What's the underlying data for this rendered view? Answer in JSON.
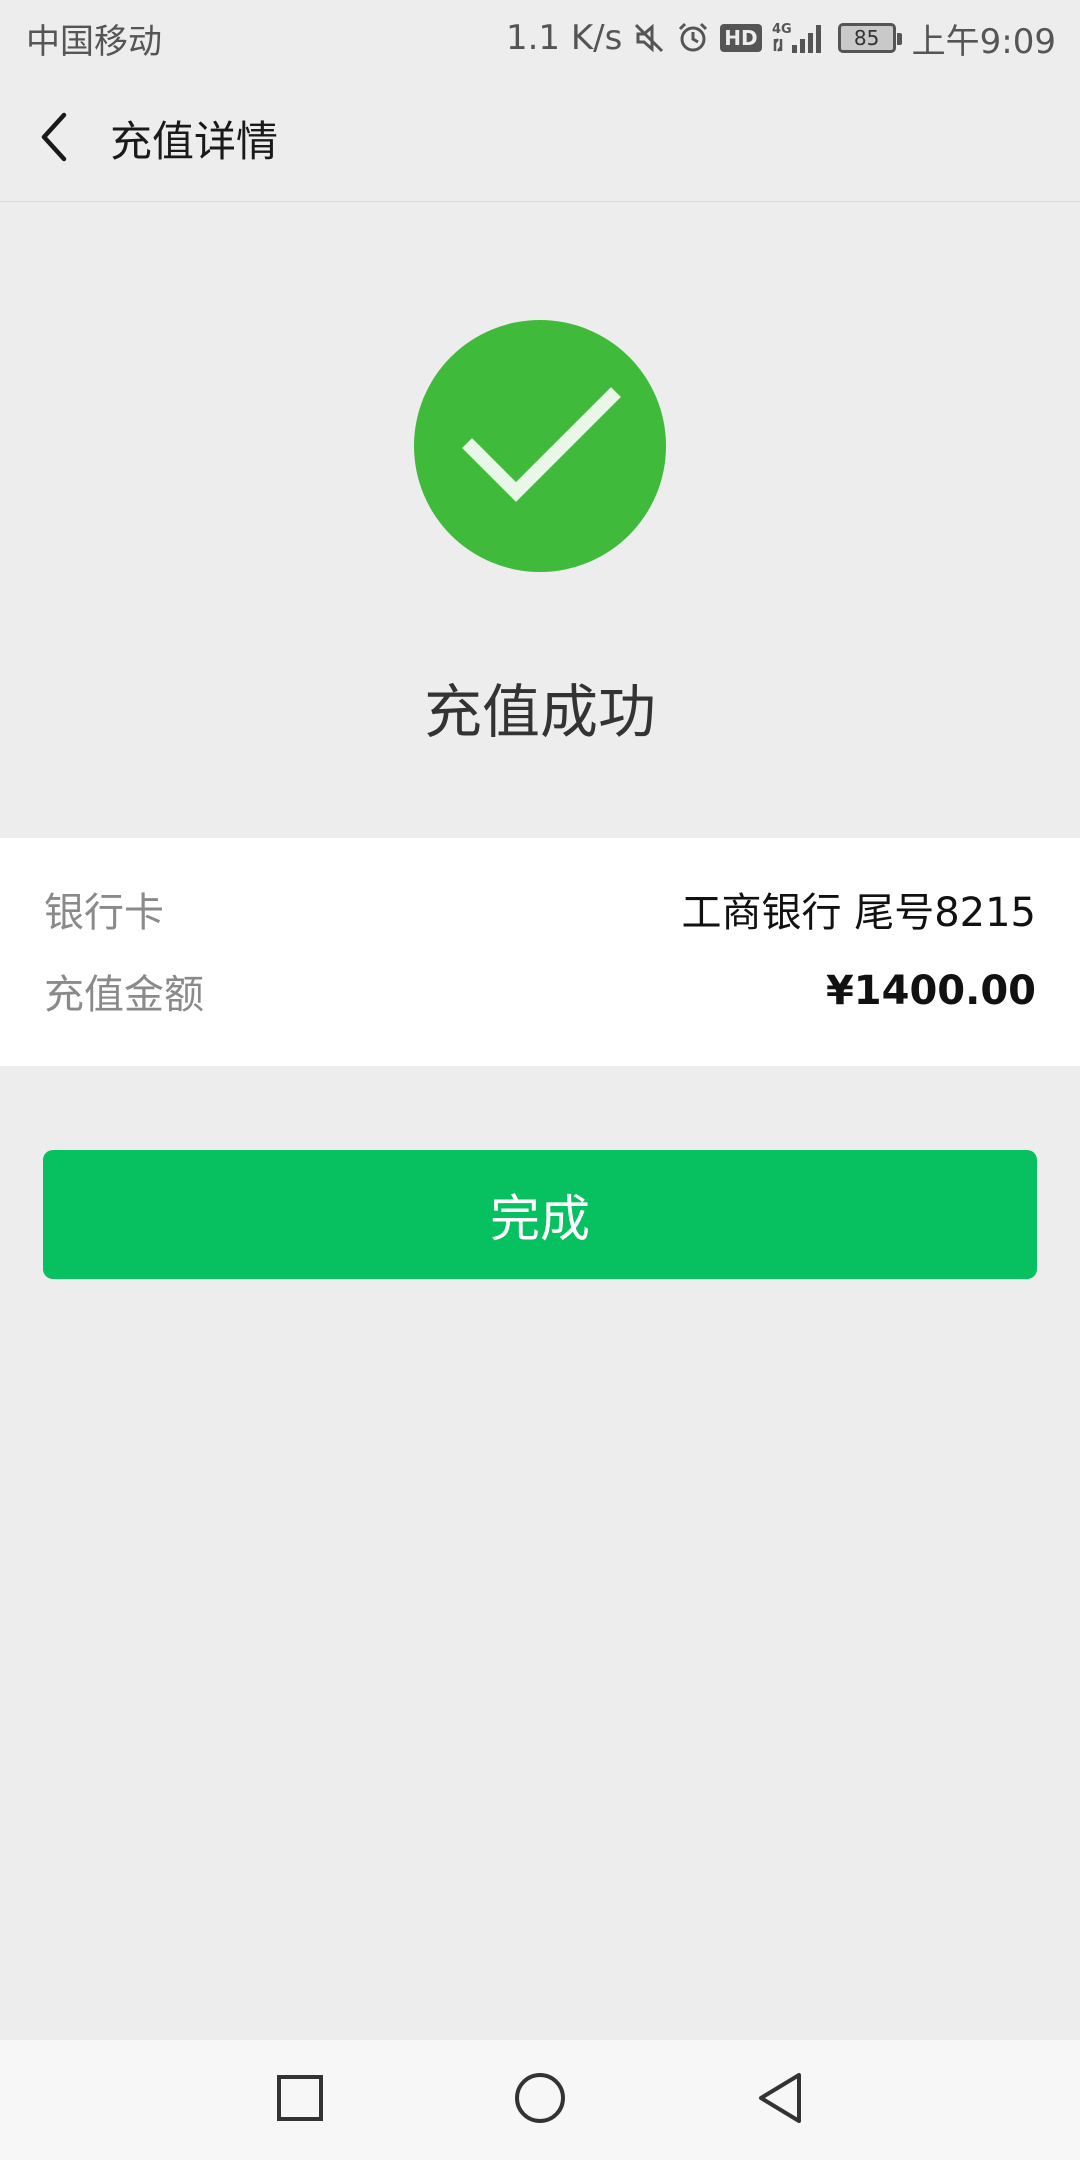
{
  "status_bar": {
    "carrier": "中国移动",
    "speed": "1.1 K/s",
    "hd": "HD",
    "network": "4G",
    "battery": "85",
    "time": "上午9:09",
    "icons": [
      "mute-icon",
      "alarm-icon",
      "hd-icon",
      "signal-icon",
      "battery-icon"
    ]
  },
  "nav": {
    "title": "充值详情",
    "back_icon": "back-arrow-icon"
  },
  "result": {
    "icon": "check-circle-icon",
    "title": "充值成功",
    "accent_color": "#3fba3a"
  },
  "details": {
    "bank_label": "银行卡",
    "bank_value": "工商银行 尾号8215",
    "amount_label": "充值金额",
    "amount_value": "¥1400.00"
  },
  "actions": {
    "done_label": "完成",
    "button_color": "#07c160"
  },
  "system_nav": {
    "icons": [
      "recent-apps-icon",
      "home-icon",
      "back-icon"
    ]
  }
}
